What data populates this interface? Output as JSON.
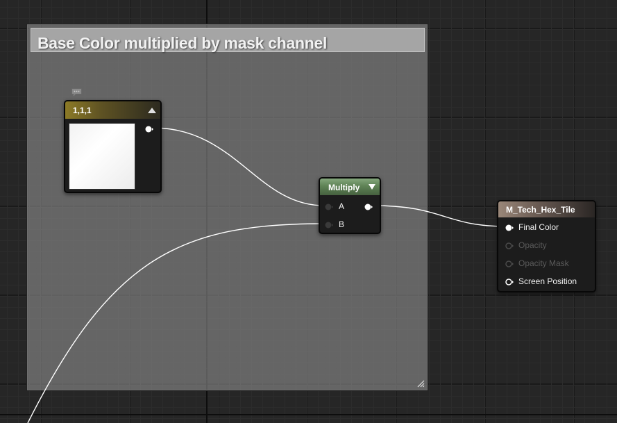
{
  "comment": {
    "title": "Base Color multiplied by mask channel"
  },
  "constant_node": {
    "title": "1,1,1",
    "color": "#ffffff",
    "output_pin_connected": true
  },
  "multiply_node": {
    "title": "Multiply",
    "header_color": "#5f8356",
    "inputs": [
      {
        "label": "A",
        "connected": true
      },
      {
        "label": "B",
        "connected": true
      }
    ]
  },
  "material_node": {
    "title": "M_Tech_Hex_Tile",
    "inputs": [
      {
        "label": "Final Color",
        "enabled": true,
        "connected": true
      },
      {
        "label": "Opacity",
        "enabled": false,
        "connected": false
      },
      {
        "label": "Opacity Mask",
        "enabled": false,
        "connected": false
      },
      {
        "label": "Screen Position",
        "enabled": true,
        "connected": false
      }
    ]
  },
  "icons": {
    "comment_bubble": "comment-bubble-icon",
    "collapse": "collapse-arrow-icon",
    "dropdown": "dropdown-arrow-icon",
    "resize": "resize-handle-icon"
  },
  "colors": {
    "canvas_background": "#262626",
    "wire": "#ffffff",
    "constant_header": "#8c7a26",
    "material_header": "#9a8779"
  }
}
